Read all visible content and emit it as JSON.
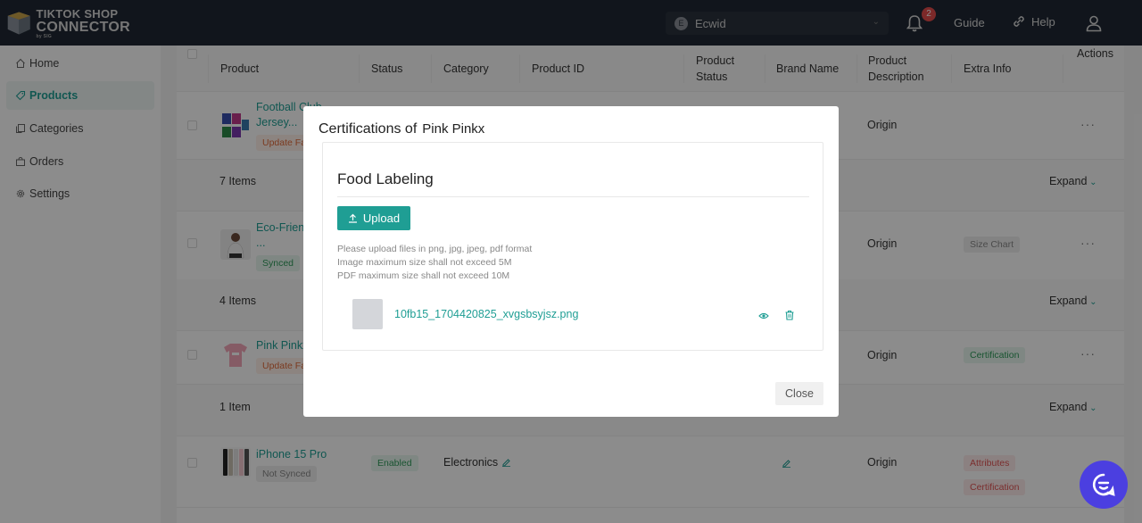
{
  "header": {
    "logo_line1": "TIKTOK SHOP",
    "logo_line2": "CONNECTOR",
    "logo_line3": "by SIG",
    "store_initial": "E",
    "store_name": "Ecwid",
    "notification_count": "2",
    "guide_label": "Guide",
    "help_label": "Help"
  },
  "sidebar": {
    "items": [
      {
        "label": "Home",
        "icon": "home-icon"
      },
      {
        "label": "Products",
        "icon": "tag-icon",
        "active": true
      },
      {
        "label": "Categories",
        "icon": "copy-icon"
      },
      {
        "label": "Orders",
        "icon": "bag-icon"
      },
      {
        "label": "Settings",
        "icon": "gear-icon"
      }
    ]
  },
  "table": {
    "columns": [
      "Product",
      "Status",
      "Category",
      "Product ID",
      "Product Status",
      "Brand Name",
      "Product Description",
      "Extra Info",
      "Actions"
    ],
    "rows": [
      {
        "name": "Football Club Jersey...",
        "tag": "Update Failed",
        "description": "Origin",
        "actions": "···",
        "sub_count": "7 Items",
        "expand": "Expand"
      },
      {
        "name": "Eco-Friendly ...",
        "tag": "Synced",
        "description": "Origin",
        "extra": "Size Chart",
        "actions": "···",
        "sub_count": "4 Items",
        "expand": "Expand"
      },
      {
        "name": "Pink Pinkx",
        "tag": "Update Failed",
        "description": "Origin",
        "extra": "Certification",
        "actions": "···",
        "sub_count": "1 Item",
        "expand": "Expand"
      },
      {
        "name": "iPhone 15 Pro",
        "tag": "Not Synced",
        "status": "Enabled",
        "category": "Electronics",
        "description": "Origin",
        "extra": "Attributes",
        "extra2": "Certification",
        "actions": "···"
      }
    ]
  },
  "modal": {
    "title_prefix": "Certifications of",
    "title_product": "Pink Pinkx",
    "section_title": "Food Labeling",
    "upload_label": "Upload",
    "hints": [
      "Please upload files in png, jpg, jpeg, pdf format",
      "Image maximum size shall not exceed 5M",
      "PDF maximum size shall not exceed 10M"
    ],
    "file_name": "10fb15_1704420825_xvgsbsyjsz.png",
    "close_label": "Close"
  },
  "colors": {
    "accent": "#1f9e94",
    "topbar": "#1f2733",
    "chat": "#4b3fe0",
    "badge": "#e24b4b"
  }
}
